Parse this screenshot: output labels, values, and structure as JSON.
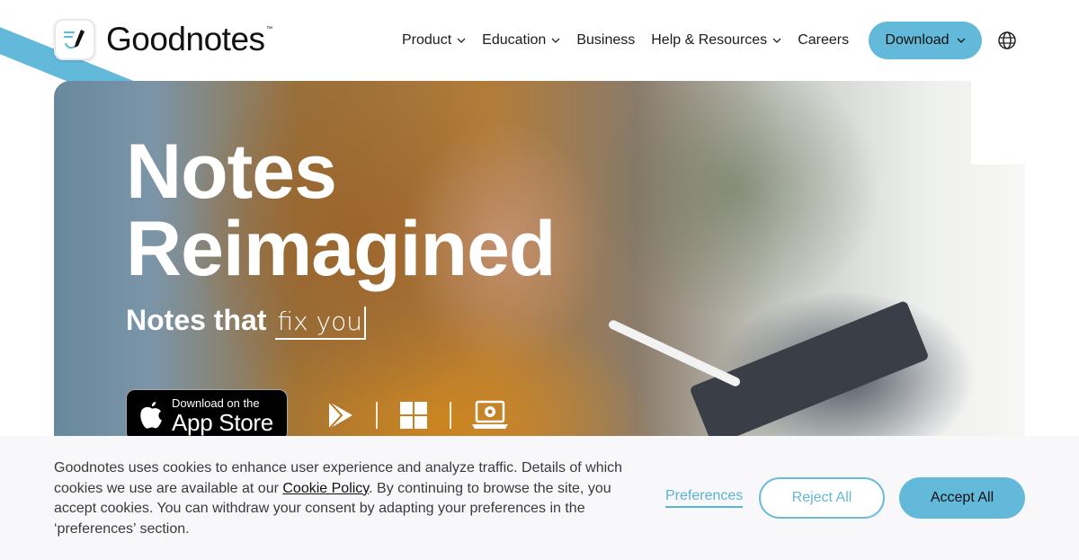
{
  "brand": {
    "name": "Goodnotes",
    "trademark": "™",
    "accent_color": "#63b9d9"
  },
  "nav": {
    "items": [
      {
        "label": "Product",
        "has_dropdown": true
      },
      {
        "label": "Education",
        "has_dropdown": true
      },
      {
        "label": "Business",
        "has_dropdown": false
      },
      {
        "label": "Help & Resources",
        "has_dropdown": true
      },
      {
        "label": "Careers",
        "has_dropdown": false
      }
    ],
    "download_label": "Download",
    "language_icon": "globe-icon"
  },
  "hero": {
    "title_line1": "Notes",
    "title_line2": "Reimagined",
    "subtitle_prefix": "Notes that",
    "subtitle_script": "fix you",
    "app_store": {
      "small_text": "Download on the",
      "big_text": "App Store",
      "icon": "apple-icon"
    },
    "platform_icons": [
      "google-play-icon",
      "windows-icon",
      "chromebook-icon"
    ]
  },
  "cookie_banner": {
    "text_before_link": "Goodnotes uses cookies to enhance user experience and analyze traffic. Details of which cookies we use are available at our ",
    "link_text": "Cookie Policy",
    "text_after_link": ". By continuing to browse the site, you accept cookies. You can withdraw your consent by adapting your preferences in the ‘preferences’ section.",
    "preferences_label": "Preferences",
    "reject_label": "Reject All",
    "accept_label": "Accept All"
  }
}
